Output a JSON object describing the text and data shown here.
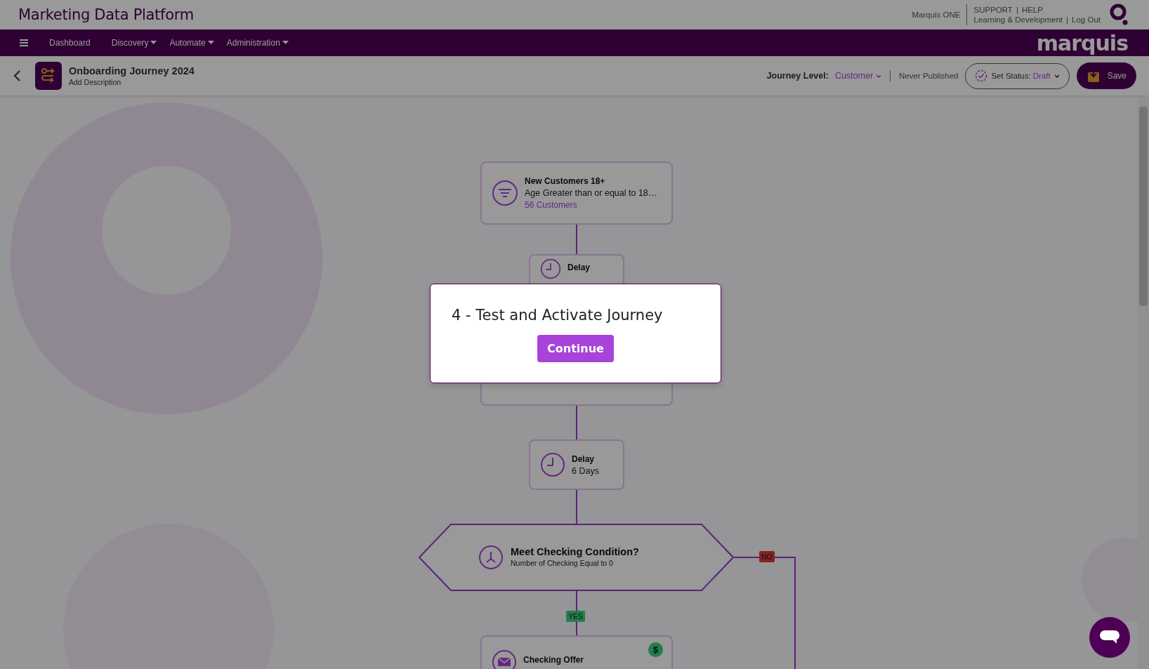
{
  "header": {
    "title": "Marketing Data Platform",
    "product_link": "Marquis ONE",
    "top_links": [
      "SUPPORT",
      "HELP"
    ],
    "bottom_links": [
      "Learning & Development",
      "Log Out"
    ],
    "separator": "|"
  },
  "nav": {
    "items": [
      {
        "label": "Dashboard",
        "dropdown": false
      },
      {
        "label": "Discovery",
        "dropdown": true
      },
      {
        "label": "Automate",
        "dropdown": true
      },
      {
        "label": "Administration",
        "dropdown": true
      }
    ],
    "logo": "marquis"
  },
  "journey": {
    "title": "Onboarding Journey 2024",
    "description": "Add Description",
    "level_label": "Journey Level:",
    "level": "Customer",
    "publish_status": "Never Published",
    "status_label": "Set Status:",
    "status": "Draft",
    "save": "Save"
  },
  "nodes": [
    {
      "kind": "audience",
      "title": "New Customers 18+",
      "subtitle": "Age Greater than or equal to 18…",
      "count": "56 Customers"
    },
    {
      "kind": "delay",
      "title": "Delay"
    },
    {
      "kind": "blank"
    },
    {
      "kind": "delay",
      "title": "Delay",
      "subtitle": "6 Days"
    },
    {
      "kind": "decision",
      "title": "Meet Checking Condition?",
      "subtitle": "Number of Checking Equal to 0",
      "yes": "YES",
      "no": "NO"
    },
    {
      "kind": "email",
      "title": "Checking Offer",
      "badge": "$"
    }
  ],
  "modal": {
    "title": "4 - Test and Activate Journey",
    "button": "Continue"
  }
}
